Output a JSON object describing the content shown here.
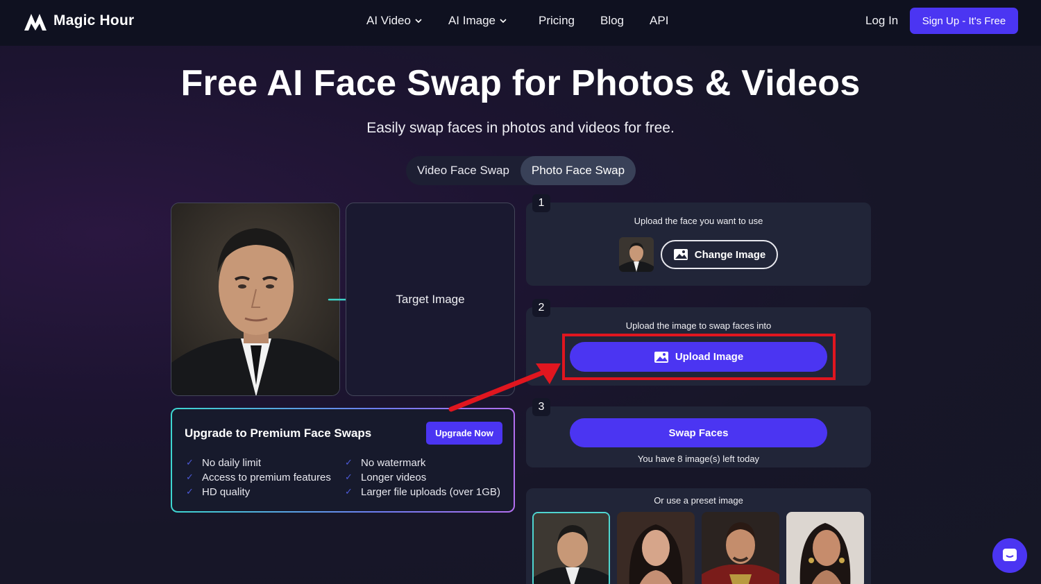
{
  "nav": {
    "brand": "Magic Hour",
    "links": [
      {
        "label": "AI Video",
        "dropdown": true
      },
      {
        "label": "AI Image",
        "dropdown": true
      },
      {
        "label": "Pricing",
        "dropdown": false
      },
      {
        "label": "Blog",
        "dropdown": false
      },
      {
        "label": "API",
        "dropdown": false
      }
    ],
    "login": "Log In",
    "signup": "Sign Up  - It's Free"
  },
  "hero": {
    "title": "Free AI Face Swap for Photos & Videos",
    "subtitle": "Easily swap faces in photos and videos for free."
  },
  "modes": {
    "video": "Video Face Swap",
    "photo": "Photo Face Swap",
    "selected": "photo"
  },
  "preview": {
    "target_label": "Target Image"
  },
  "upgrade": {
    "title": "Upgrade to Premium Face Swaps",
    "button": "Upgrade Now",
    "features_left": [
      "No daily limit",
      "Access to premium features",
      "HD quality"
    ],
    "features_right": [
      "No watermark",
      "Longer videos",
      "Larger file uploads (over 1GB)"
    ]
  },
  "steps": {
    "s1": {
      "num": "1",
      "caption": "Upload the face you want to use",
      "button": "Change Image"
    },
    "s2": {
      "num": "2",
      "caption": "Upload the image to swap faces into",
      "button": "Upload Image"
    },
    "s3": {
      "num": "3",
      "button": "Swap Faces",
      "note": "You have 8 image(s) left today"
    }
  },
  "presets": {
    "caption": "Or use a preset image",
    "items": [
      "preset-man-suit",
      "preset-woman-dark-hair",
      "preset-man-armor",
      "preset-woman-jewelry"
    ]
  },
  "colors": {
    "accent": "#4b35f2",
    "highlight": "#e0161f",
    "teal": "#3dd6d0"
  }
}
